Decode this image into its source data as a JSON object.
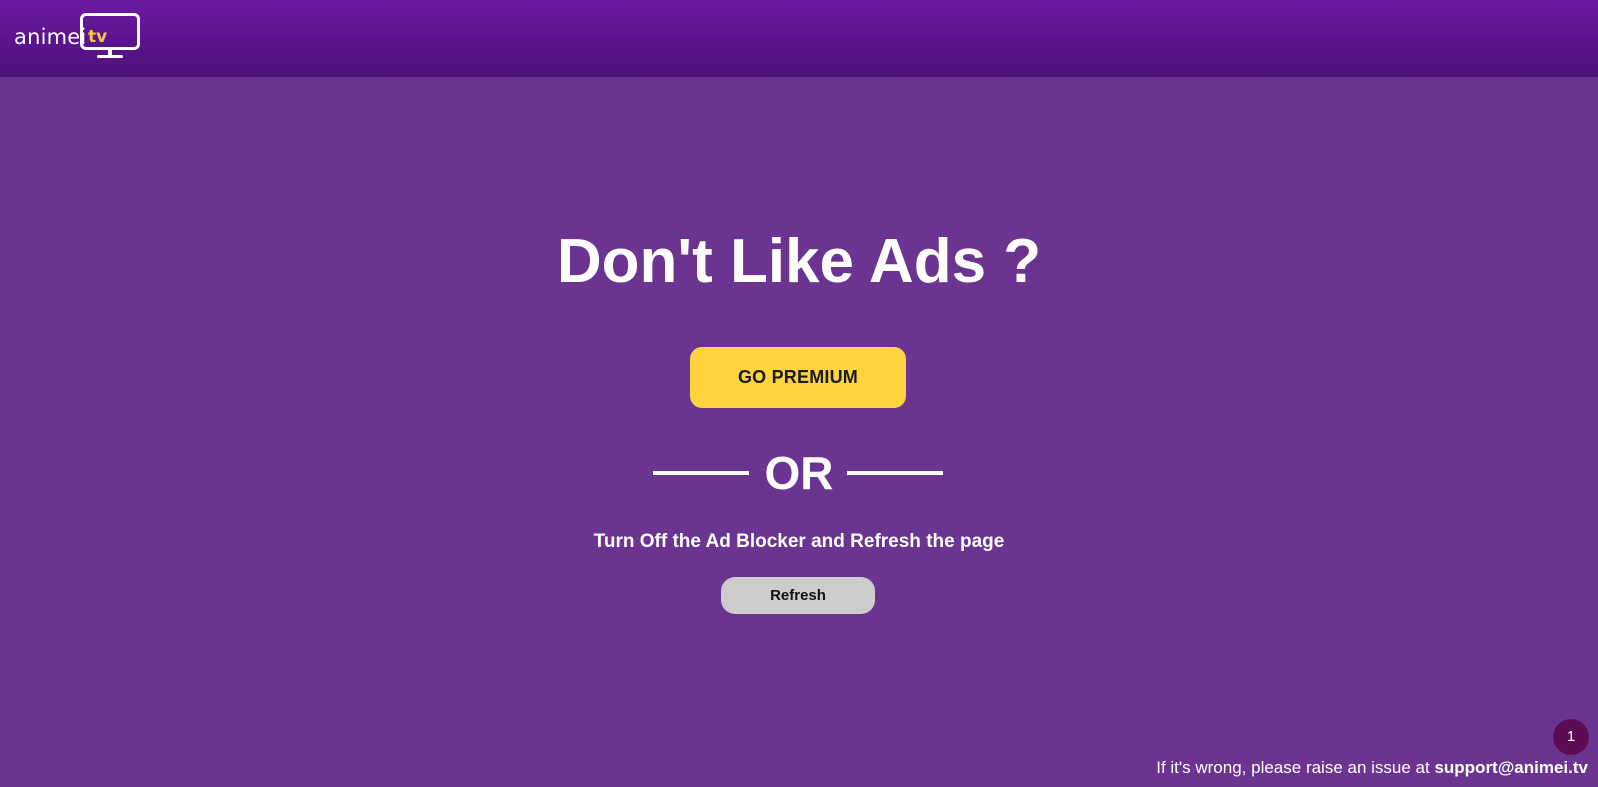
{
  "header": {
    "logo": {
      "word": "animei",
      "tv": "tv",
      "icon": "tv-screen-icon"
    }
  },
  "main": {
    "headline": "Don't Like Ads ?",
    "premium_button": "GO PREMIUM",
    "divider_text": "OR",
    "instructions": "Turn Off the Ad Blocker and Refresh the page",
    "refresh_button": "Refresh"
  },
  "badge": {
    "count": "1"
  },
  "footer": {
    "prefix": "If it's wrong, please raise an issue at ",
    "email": "support@animei.tv"
  },
  "colors": {
    "background": "#6a3490",
    "header": "#5a148c",
    "accent_yellow": "#fdd440",
    "refresh_grey": "#cccccc",
    "badge": "#5e0b55"
  }
}
